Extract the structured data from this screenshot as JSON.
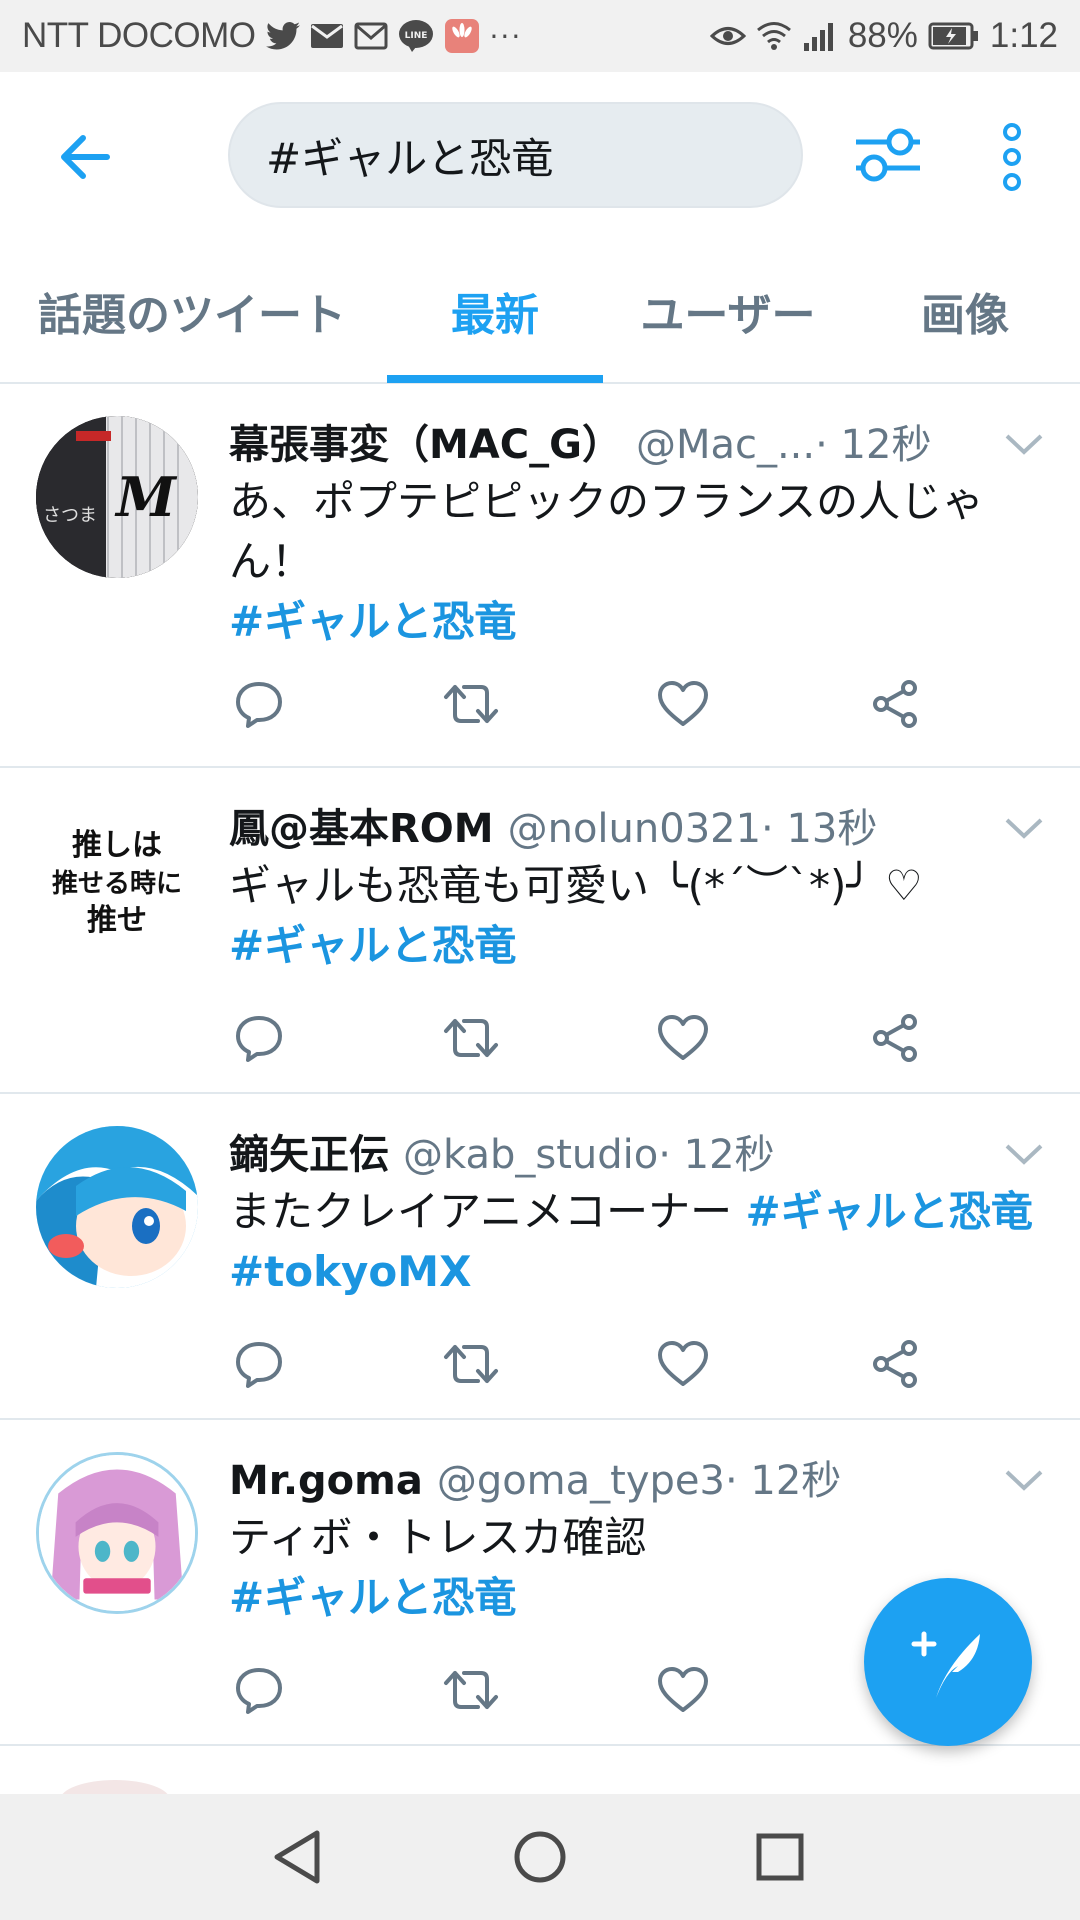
{
  "status_bar": {
    "carrier": "NTT DOCOMO",
    "notification_icons": [
      "twitter-icon",
      "mail-icon",
      "gmail-icon",
      "line-icon",
      "huawei-icon",
      "more-dots-icon"
    ],
    "more": "···",
    "battery": "88%",
    "time": "1:12"
  },
  "search": {
    "query": "#ギャルと恐竜"
  },
  "tabs": [
    {
      "label": "話題のツイート",
      "active": false
    },
    {
      "label": "最新",
      "active": true
    },
    {
      "label": "ユーザー",
      "active": false
    },
    {
      "label": "画像",
      "active": false
    }
  ],
  "tweets": [
    {
      "name": "幕張事変（MAC_G）",
      "handle": "@Mac_...",
      "time": " · 12秒",
      "text": "あ、ポプテピピックのフランスの人じゃん！",
      "hashtags": "#ギャルと恐竜",
      "avatar": "baseball-jersey-avatar"
    },
    {
      "name": "鳳@基本ROM",
      "handle": "@nolun0321",
      "time": " · 13秒",
      "text": "ギャルも恐竜も可愛い ╰(*´︶`*)╯ ♡",
      "hashtags": "#ギャルと恐竜",
      "avatar": "calligraphy-avatar"
    },
    {
      "name": "鏑矢正伝",
      "handle": "@kab_studio",
      "time": " · 12秒",
      "text": "またクレイアニメコーナー ",
      "hashtags": "#ギャルと恐竜 #tokyoMX",
      "avatar": "blue-hair-anime-avatar"
    },
    {
      "name": "Mr.goma",
      "handle": "@goma_type3",
      "time": " · 12秒",
      "text": "ティボ・トレスカ確認",
      "hashtags": "#ギャルと恐竜",
      "avatar": "pink-hair-anime-avatar"
    }
  ],
  "colors": {
    "accent": "#1da1f2",
    "hashtag": "#1b95e0",
    "secondary_text": "#657786",
    "divider": "#e1e8ed"
  },
  "fab": {
    "icon": "compose-tweet-icon"
  },
  "nav": {
    "icons": [
      "back-triangle-icon",
      "home-circle-icon",
      "recents-square-icon"
    ]
  }
}
